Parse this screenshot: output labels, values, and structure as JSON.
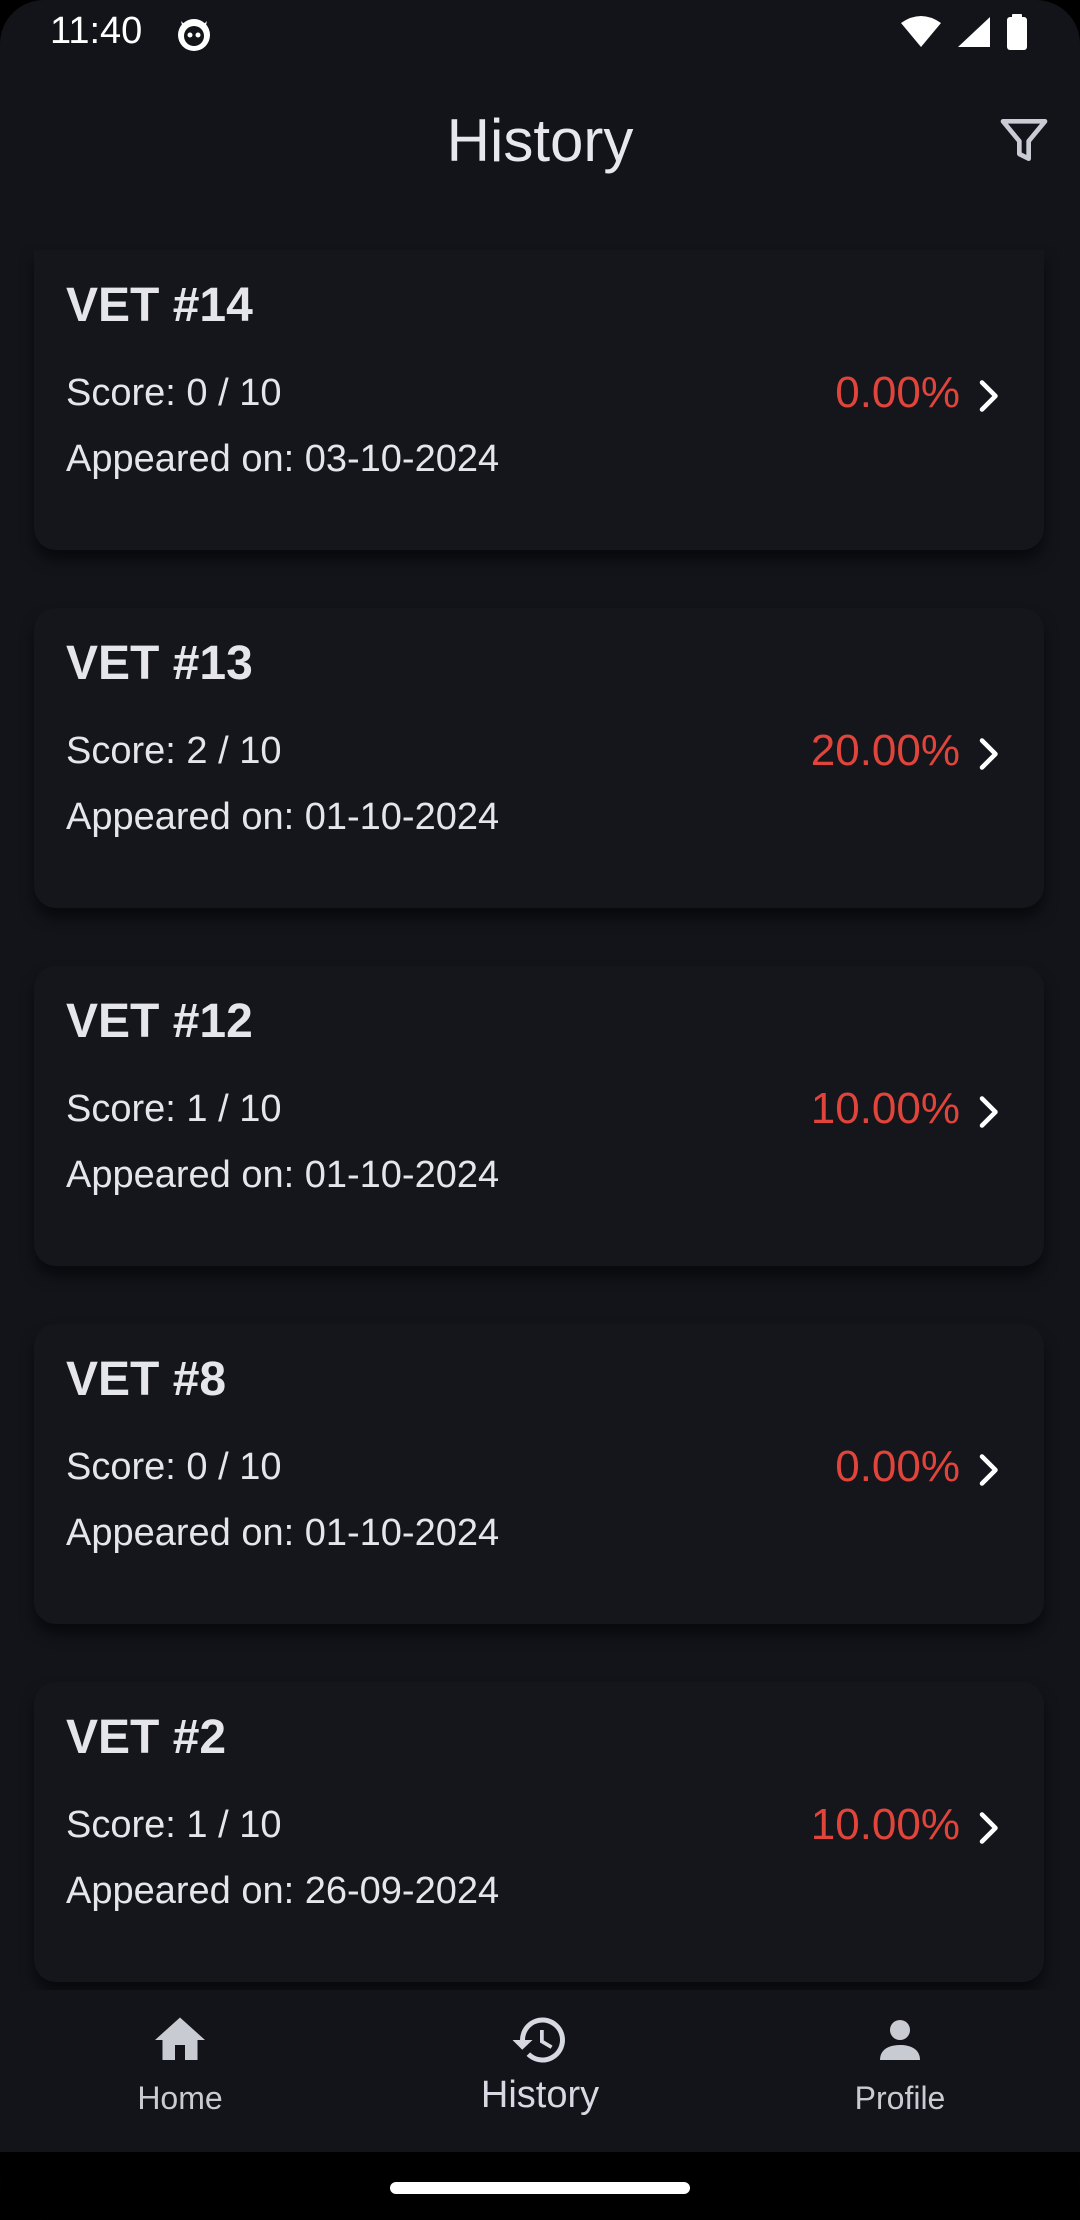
{
  "status_bar": {
    "time": "11:40"
  },
  "header": {
    "title": "History"
  },
  "history": [
    {
      "title": "VET #14",
      "score": "Score: 0 / 10",
      "date": "Appeared on: 03-10-2024",
      "percent": "0.00%"
    },
    {
      "title": "VET #13",
      "score": "Score: 2 / 10",
      "date": "Appeared on: 01-10-2024",
      "percent": "20.00%"
    },
    {
      "title": "VET #12",
      "score": "Score: 1 / 10",
      "date": "Appeared on: 01-10-2024",
      "percent": "10.00%"
    },
    {
      "title": "VET #8",
      "score": "Score: 0 / 10",
      "date": "Appeared on: 01-10-2024",
      "percent": "0.00%"
    },
    {
      "title": "VET #2",
      "score": "Score: 1 / 10",
      "date": "Appeared on: 26-09-2024",
      "percent": "10.00%"
    }
  ],
  "bottom_nav": {
    "home": "Home",
    "history": "History",
    "profile": "Profile"
  },
  "colors": {
    "background": "#12141a",
    "percent_low": "#e0443a",
    "text": "#e6e6ea"
  },
  "icons": {
    "filter": "filter-icon",
    "chevron": "chevron-right-icon",
    "home": "home-icon",
    "history": "history-icon",
    "profile": "person-icon"
  }
}
